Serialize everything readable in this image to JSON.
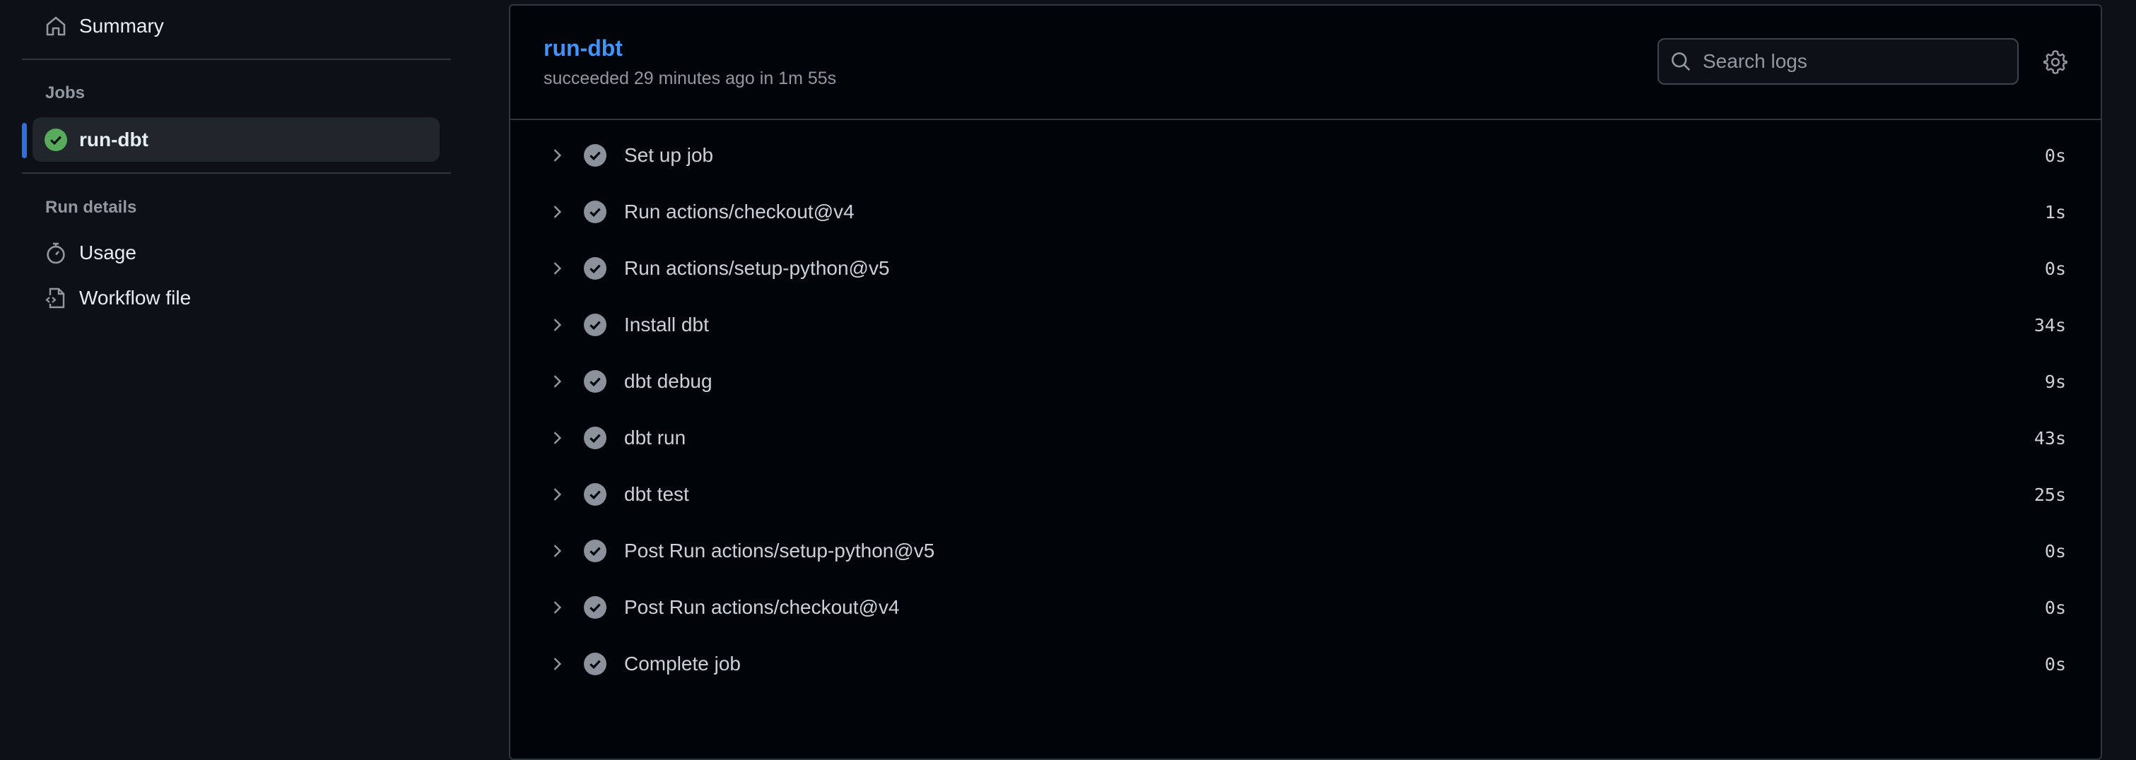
{
  "sidebar": {
    "summary": "Summary",
    "jobs_label": "Jobs",
    "jobs": [
      {
        "label": "run-dbt",
        "status": "success"
      }
    ],
    "run_details_label": "Run details",
    "usage": "Usage",
    "workflow_file": "Workflow file"
  },
  "job": {
    "title": "run-dbt",
    "subtitle": "succeeded 29 minutes ago in 1m 55s",
    "search_placeholder": "Search logs",
    "steps": [
      {
        "name": "Set up job",
        "duration": "0s"
      },
      {
        "name": "Run actions/checkout@v4",
        "duration": "1s"
      },
      {
        "name": "Run actions/setup-python@v5",
        "duration": "0s"
      },
      {
        "name": "Install dbt",
        "duration": "34s"
      },
      {
        "name": "dbt debug",
        "duration": "9s"
      },
      {
        "name": "dbt run",
        "duration": "43s"
      },
      {
        "name": "dbt test",
        "duration": "25s"
      },
      {
        "name": "Post Run actions/setup-python@v5",
        "duration": "0s"
      },
      {
        "name": "Post Run actions/checkout@v4",
        "duration": "0s"
      },
      {
        "name": "Complete job",
        "duration": "0s"
      }
    ]
  },
  "colors": {
    "accent": "#4493f8",
    "success": "#3fb950",
    "selected_bar": "#2f6fe4"
  }
}
